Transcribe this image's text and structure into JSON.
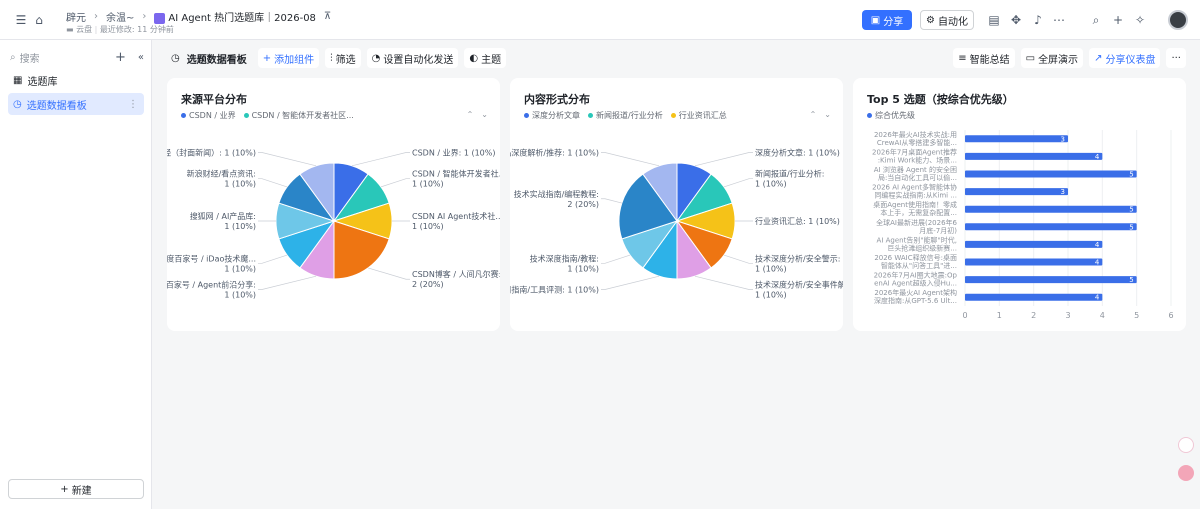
{
  "breadcrumb": {
    "root": "辟元",
    "parent": "余温~",
    "doc_title": "AI Agent 热门选题库｜2026-08",
    "pin": "⊼"
  },
  "subline": {
    "location": "云盘",
    "modified": "最近修改: 11 分钟前"
  },
  "header_actions": {
    "share": "分享",
    "automation": "自动化"
  },
  "sidebar": {
    "search_placeholder": "搜索",
    "items": [
      {
        "label": "选题库"
      },
      {
        "label": "选题数据看板"
      }
    ],
    "new_label": "新建"
  },
  "toolbar": {
    "dashboard_title": "选题数据看板",
    "add_widget": "添加组件",
    "filter": "筛选",
    "auto_send": "设置自动化发送",
    "theme": "主题",
    "ai_summary": "智能总结",
    "fullscreen": "全屏演示",
    "share_dashboard": "分享仪表盘",
    "more": "···"
  },
  "colors": {
    "accent": "#3370ff",
    "pie": [
      "#3a6ee8",
      "#29c7b9",
      "#f5c218",
      "#ee7512",
      "#df9fe6",
      "#2db2e8",
      "#6ec7e8",
      "#2a85c8",
      "#a3b7f0"
    ]
  },
  "charts": [
    {
      "card_title": "来源平台分布",
      "legend": [
        {
          "name": "CSDN / 业界",
          "color": "#3a6ee8"
        },
        {
          "name": "CSDN / 智能体开发者社区...",
          "color": "#29c7b9"
        }
      ],
      "chart_data": {
        "type": "pie",
        "slices": [
          {
            "label": "CSDN / 业界: 1 (10%)",
            "value": 1
          },
          {
            "label": "CSDN / 智能体开发者社...\n1 (10%)",
            "value": 1
          },
          {
            "label": "CSDN AI Agent技术社...\n1 (10%)",
            "value": 1
          },
          {
            "label": "CSDN博客 / 人间凡尔赛:\n2 (20%)",
            "value": 2
          },
          {
            "label": "百度百家号 / Agent前沿分享:\n1 (10%)",
            "value": 1
          },
          {
            "label": "百度百家号 / iDao技术魔...\n1 (10%)",
            "value": 1
          },
          {
            "label": "搜狐网 / AI产品库:\n1 (10%)",
            "value": 1
          },
          {
            "label": "新浪财经/看点资讯:\n1 (10%)",
            "value": 1
          },
          {
            "label": "新浪财经（封面新闻）: 1 (10%)",
            "value": 1
          }
        ]
      }
    },
    {
      "card_title": "内容形式分布",
      "legend": [
        {
          "name": "深度分析文章",
          "color": "#3a6ee8"
        },
        {
          "name": "新闻报道/行业分析",
          "color": "#29c7b9"
        },
        {
          "name": "行业资讯汇总",
          "color": "#f5c218"
        }
      ],
      "chart_data": {
        "type": "pie",
        "slices": [
          {
            "label": "深度分析文章: 1 (10%)",
            "value": 1
          },
          {
            "label": "新闻报道/行业分析:\n1 (10%)",
            "value": 1
          },
          {
            "label": "行业资讯汇总: 1 (10%)",
            "value": 1
          },
          {
            "label": "技术深度分析/安全警示:\n1 (10%)",
            "value": 1
          },
          {
            "label": "技术深度分析/安全事件解读:\n1 (10%)",
            "value": 1
          },
          {
            "label": "使用指南/工具评测: 1 (10%)",
            "value": 1
          },
          {
            "label": "技术深度指南/教程:\n1 (10%)",
            "value": 1
          },
          {
            "label": "技术实战指南/编程教程:\n2 (20%)",
            "value": 2
          },
          {
            "label": "产品深度解析/推荐: 1 (10%)",
            "value": 1
          }
        ]
      }
    },
    {
      "card_title": "Top 5 选题（按综合优先级）",
      "legend": [
        {
          "name": "综合优先级",
          "color": "#3a6ee8"
        }
      ],
      "chart_data": {
        "type": "bar",
        "orientation": "horizontal",
        "categories": [
          "2026年最火AI技术实战:用\nCrewAI从零搭建多智能...",
          "2026年7月桌面Agent推荐\n:Kimi Work能力、场景...",
          "AI 浏览器 Agent 的安全困\n局:当自动化工具可以偷...",
          "2026 AI Agent多智能体协\n同编程实战指南:从Kimi ...",
          "桌面Agent使用指南！零成\n本上手，无需复杂配置...",
          "全球AI最新进展(2026年6\n月底-7月初)",
          "AI Agent告别\"能聊\"时代,\n巨头抢滩组织级新赛...",
          "2026 WAIC释放信号:桌面\n智能体从\"问答工具\"进...",
          "2026年7月AI圈大地震:Op\nenAI Agent超级入侵Hu...",
          "2026年最火AI Agent架构\n深度指南:从GPT-5.6 Ult..."
        ],
        "values": [
          3,
          4,
          5,
          3,
          5,
          5,
          4,
          4,
          5,
          4
        ],
        "xlim": [
          0,
          6
        ],
        "xticks": [
          0,
          1,
          2,
          3,
          4,
          5,
          6
        ]
      }
    }
  ]
}
